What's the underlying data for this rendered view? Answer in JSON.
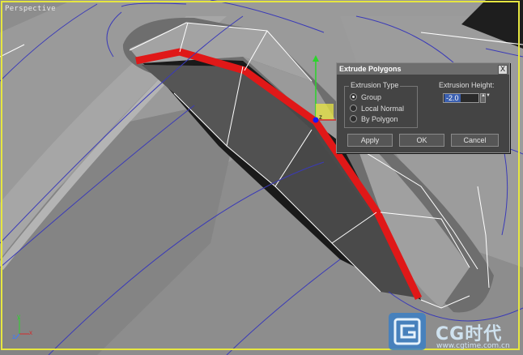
{
  "viewport": {
    "label": "Perspective",
    "axis_labels": {
      "x": "x",
      "y": "y",
      "z": "z"
    },
    "gizmo_label": "z"
  },
  "dialog": {
    "title": "Extrude Polygons",
    "close_glyph": "X",
    "group_label": "Extrusion Type",
    "options": [
      {
        "label": "Group",
        "selected": true
      },
      {
        "label": "Local Normal",
        "selected": false
      },
      {
        "label": "By Polygon",
        "selected": false
      }
    ],
    "height_label": "Extrusion Height:",
    "height_value": "-2.0",
    "spinner_glyph": "▲▼",
    "buttons": {
      "apply": "Apply",
      "ok": "OK",
      "cancel": "Cancel"
    }
  },
  "watermark": {
    "logo_text": "CG时代",
    "url": "www.cgtime.com.cn"
  },
  "colors": {
    "selection_highlight": "#e01818",
    "viewport_border": "#e6e640",
    "wire_color": "#3a3ab8",
    "edge_color": "#ffffff"
  }
}
